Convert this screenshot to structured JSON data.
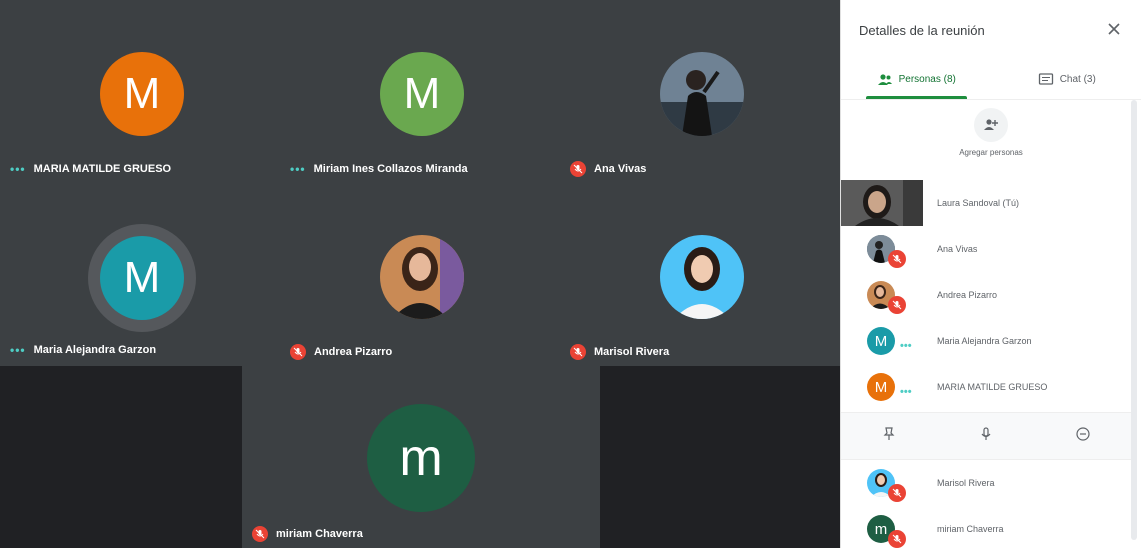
{
  "grid": {
    "tiles": [
      {
        "name": "MARIA MATILDE GRUESO",
        "initial": "M",
        "color": "#e8710a",
        "status": "speaking"
      },
      {
        "name": "Miriam Ines Collazos Miranda",
        "initial": "M",
        "color": "#6aa84f",
        "status": "speaking"
      },
      {
        "name": "Ana Vivas",
        "initial": "",
        "color": "#546e7a",
        "status": "muted"
      },
      {
        "name": "Maria Alejandra Garzon",
        "initial": "M",
        "color": "#1a9ba8",
        "status": "speaking"
      },
      {
        "name": "Andrea Pizarro",
        "initial": "",
        "color": "#9c6b4e",
        "status": "muted"
      },
      {
        "name": "Marisol Rivera",
        "initial": "",
        "color": "#4fc3f7",
        "status": "muted"
      },
      {
        "name": "miriam Chaverra",
        "initial": "m",
        "color": "#1e5e43",
        "status": "muted"
      }
    ]
  },
  "panel": {
    "title": "Detalles de la reunión",
    "tabs": [
      {
        "label": "Personas (8)"
      },
      {
        "label": "Chat (3)"
      }
    ],
    "add_people_label": "Agregar personas",
    "people": [
      {
        "name": "Laura Sandoval (Tú)",
        "initial": "",
        "color": "#424242"
      },
      {
        "name": "Ana Vivas",
        "initial": "",
        "color": "#546e7a"
      },
      {
        "name": "Andrea Pizarro",
        "initial": "",
        "color": "#9c6b4e"
      },
      {
        "name": "Maria Alejandra Garzon",
        "initial": "M",
        "color": "#1a9ba8"
      },
      {
        "name": "MARIA MATILDE GRUESO",
        "initial": "M",
        "color": "#e8710a"
      }
    ],
    "people_below": [
      {
        "name": "Marisol Rivera",
        "initial": "",
        "color": "#4fc3f7"
      },
      {
        "name": "miriam Chaverra",
        "initial": "m",
        "color": "#1e5e43"
      }
    ]
  }
}
